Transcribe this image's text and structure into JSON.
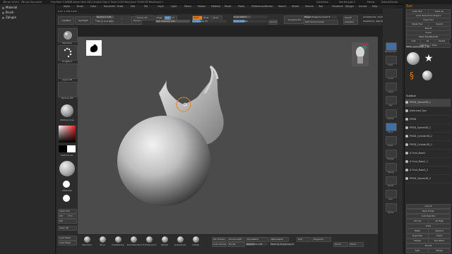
{
  "titlebar": {
    "app": "ZBrush 2018.1",
    "doc": "ZBrush Document",
    "info": "Free Mem 7.006GB  Active Mem 2621  Scratch Disk 0  Timer 0.034  PolyCount 79.600 KP  MeshCount 1",
    "quicksave": "QuickSave",
    "seethrough": "See-through 0",
    "menus_label": "Menus",
    "script_label": "DefaultZScript"
  },
  "menu": [
    "Alpha",
    "Brush",
    "Color",
    "Document",
    "Draw",
    "Edit",
    "File",
    "Layer",
    "Light",
    "Macro",
    "Marker",
    "Material",
    "Movie",
    "Picker",
    "Preferences",
    "Render",
    "Stencil",
    "Stroke",
    "Texture",
    "Tool",
    "Transform",
    "Zplugin",
    "Zscript",
    "Help"
  ],
  "left_panel": {
    "items": [
      "Material",
      "Brush",
      "Zplugin"
    ]
  },
  "coords": "0.87,-1.185,0.635",
  "shelf_top": {
    "buttons": [
      {
        "label": "LightBox"
      },
      {
        "label": "Spotlight"
      },
      {
        "label": "Edit"
      },
      {
        "label": "Draw"
      },
      {
        "label": "Move"
      },
      {
        "label": "Scale"
      },
      {
        "label": "Rotate"
      },
      {
        "label": "Sculptris Pro"
      }
    ],
    "sliders": [
      {
        "label": "Backface 128",
        "fill": 0.5
      },
      {
        "label": "Mirror And Weld",
        "fill": 0
      },
      {
        "label": "Gizmo 3D",
        "fill": 0
      },
      {
        "label": "Rgb Intensity 100",
        "fill": 1.0
      },
      {
        "label": "Z Intensity 25",
        "fill": 0.25
      },
      {
        "label": "Draw Size 64",
        "fill": 0.35
      },
      {
        "label": "Focal Shift 0",
        "fill": 0.5
      },
      {
        "label": "Dynamic",
        "fill": 0
      },
      {
        "label": "Target Polygons Count 5",
        "fill": 0.2
      },
      {
        "label": "Half  Same  Double",
        "fill": 0
      },
      {
        "label": "ActivePoints: 70,938",
        "fill": 0
      },
      {
        "label": "TotalPoints: 408,306",
        "fill": 0
      }
    ],
    "mrgb": "Mrgb",
    "rgb": "Rgb",
    "m": "M",
    "zadd": "Zadd",
    "zsub": "Zsub",
    "zcut": "Zcut",
    "adaptive": "Adaptive",
    "use_pf": "Use PF",
    "delete": "Delete"
  },
  "left_shelf": [
    {
      "label": "Standard"
    },
    {
      "label": "DragRect"
    },
    {
      "label": "Alpha Off"
    },
    {
      "label": "Texture Off"
    },
    {
      "label": "MatCap Gray"
    }
  ],
  "left_shelf_bottom": [
    "Gradient",
    "SwitchColor",
    "Alternate",
    "Claim Old",
    "Ctrl",
    "Frm",
    "Del",
    "Clear 3D",
    "Load Mean",
    "Load Mean"
  ],
  "bottom_shelf": [
    "Standard",
    "Move",
    "ClayBuildup",
    "DamStandard",
    "TrimDynamic",
    "hPolish",
    "SnakeHook",
    "Inflate"
  ],
  "bottom_controls": {
    "divide": "Divide",
    "smt": "Smt",
    "group_split": "Groups Split",
    "dynamesh": "DynaMesh",
    "resolution": "Resolution 128",
    "del_hidden": "Del Hidden",
    "auto_groups": "Auto Groups",
    "mask_by_polygroups": "Mask By Polygroups 0",
    "zremesher": "ZRemesher",
    "polypaint": "Polypaint",
    "zoom": "Zoom",
    "move": "Move"
  },
  "right_shelf": [
    "Perspective",
    "Floor",
    "Local",
    "L.Sym",
    "Xyz",
    "Frame",
    "Move",
    "Scale",
    "Rotate",
    "Transp",
    "Ghost",
    "Solo",
    "Xpose"
  ],
  "right_panel": {
    "title": "Tool",
    "buttons": [
      "Load Tool",
      "Save As",
      "Load Tools From Project",
      "Copy Tool",
      "Paste Tool",
      "Import",
      "Export",
      "Clone",
      "Make PolyMesh3D",
      "GoZ",
      "All",
      "Visible",
      "Lightbox > Tools"
    ],
    "current_tool": "PM3D_Sphere3D_1 48",
    "thumbs": [
      "PM3D_Sphere3D_1",
      "SimpleBrush",
      "PolyMesh3D",
      "PM3D_Sphere3D"
    ],
    "subtool_header": "Subtool",
    "subtools": [
      "PM3D_Sphere3D_1",
      "Deformed_Tool",
      "PM3D",
      "PM3D_Sphere3D_1",
      "PM3D_Cylinder3D_2",
      "PM3D_Cylinder3D_1",
      "A Frust_Base1",
      "A Frust_Base1_1",
      "A Frust_Base1_2",
      "PM3D_Sphere3D_3"
    ],
    "footer": [
      "List All",
      "New Folder",
      "Auto Reorder",
      "All Low",
      "All High",
      "Copy",
      "Paste",
      "Append",
      "Duplicate",
      "Insert",
      "Delete",
      "Del Other",
      "Del All",
      "Split",
      "Merge"
    ]
  },
  "colors": {
    "canvas": "#4b4b4b",
    "accent": "#e8801f",
    "blue": "#4a8fd8",
    "model": "#c9c9c9"
  }
}
